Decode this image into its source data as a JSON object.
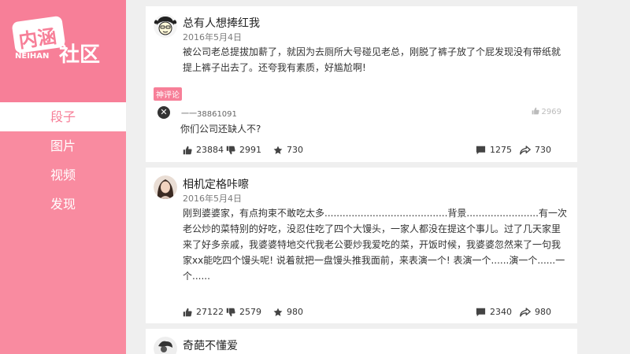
{
  "app": {
    "logo_text_1": "内涵",
    "logo_text_2": "NEIHAN",
    "logo_text_3": "社区"
  },
  "nav": {
    "items": [
      {
        "label": "段子",
        "active": true
      },
      {
        "label": "图片",
        "active": false
      },
      {
        "label": "视频",
        "active": false
      },
      {
        "label": "发现",
        "active": false
      }
    ]
  },
  "posts": [
    {
      "user": "总有人想捧红我",
      "date": "2016年5月4日",
      "content": "被公司老总提拔加薪了，就因为去厕所大号碰见老总，刚脱了裤子放了个屁发现没有带纸就提上裤子出去了。还夸我有素质，好尴尬啊!",
      "hot_comment": {
        "tag": "神评论",
        "user": "一一38861091",
        "likes": "2969",
        "text": "你们公司还缺人不?"
      },
      "stats": {
        "likes": "23884",
        "dislikes": "2991",
        "favorites": "730",
        "comments": "1275",
        "shares": "730"
      }
    },
    {
      "user": "相机定格咔嚓",
      "date": "2016年5月4日",
      "content": "刚到婆婆家，有点拘束不敢吃太多.........................................背景........................有一次老公炒的菜特别的好吃，没忍住吃了四个大馒头，一家人都没在提这个事儿。过了几天家里来了好多亲戚，我婆婆特地交代我老公要炒我爱吃的菜，开饭时候，我婆婆忽然来了一句我家xx能吃四个馒头呢! 说着就把一盘馒头推我面前，来表演一个! 表演一个......演一个......一个......",
      "stats": {
        "likes": "27122",
        "dislikes": "2579",
        "favorites": "980",
        "comments": "2340",
        "shares": "980"
      }
    },
    {
      "user": "奇葩不懂爱"
    }
  ],
  "colors": {
    "accent": "#f77f98",
    "sidebar": "#f98ba0",
    "background": "#efefef"
  }
}
